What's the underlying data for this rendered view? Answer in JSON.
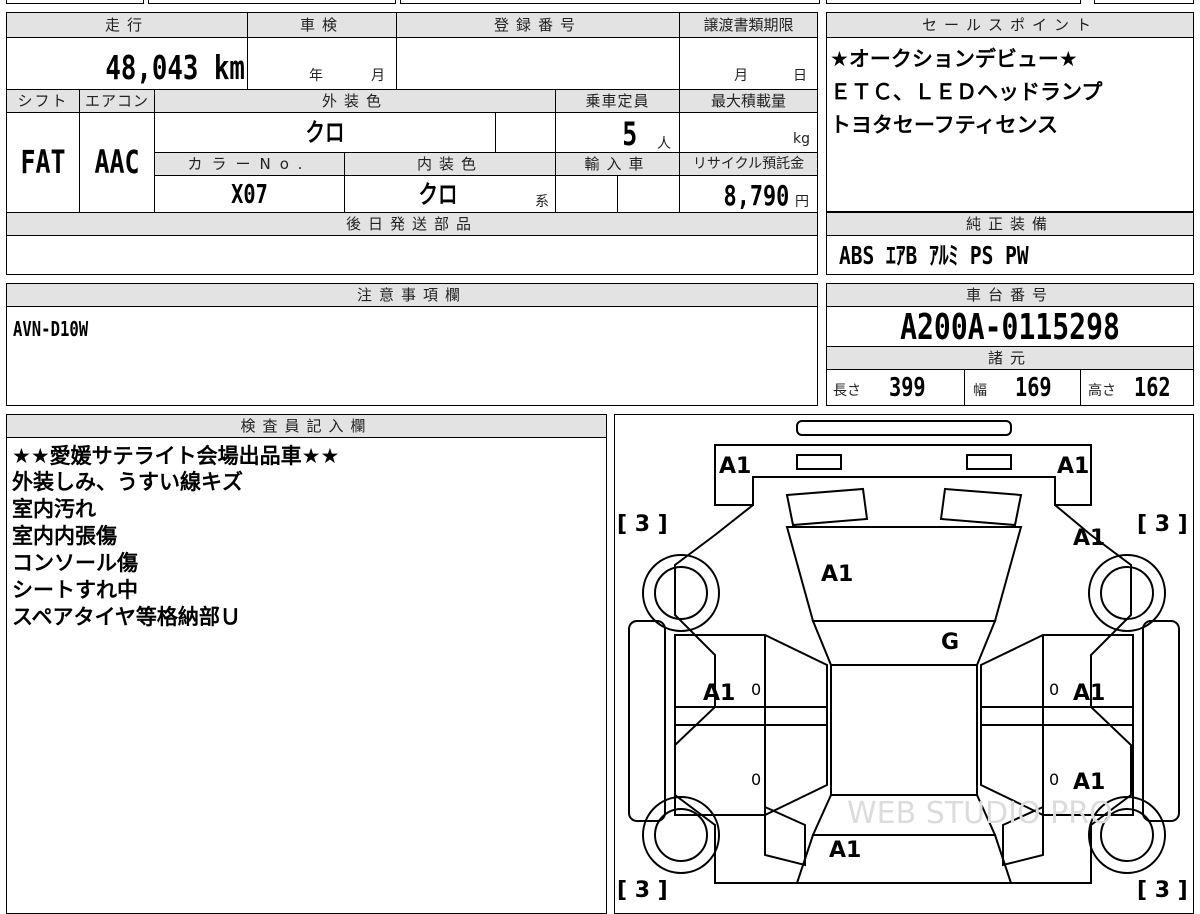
{
  "vehicle": {
    "headers": {
      "mileage": "走行",
      "inspection": "車検",
      "registration": "登録番号",
      "transfer_deadline": "譲渡書類期限",
      "shift": "シフト",
      "aircon": "エアコン",
      "exterior_color": "外装色",
      "capacity": "乗車定員",
      "max_load": "最大積載量",
      "color_no": "カラーNo.",
      "interior_color": "内装色",
      "imported": "輸入車",
      "recycle_fee": "リサイクル預託金",
      "later_parts": "後日発送部品"
    },
    "mileage": "48,043 km",
    "inspection_year_unit": "年",
    "inspection_month_unit": "月",
    "transfer_month_unit": "月",
    "transfer_day_unit": "日",
    "shift": "FAT",
    "aircon": "AAC",
    "exterior_color": "クロ",
    "capacity": "5",
    "capacity_unit": "人",
    "max_load_unit": "kg",
    "color_no": "X07",
    "interior_color": "クロ",
    "interior_color_suffix": "系",
    "recycle_fee": "8,790",
    "recycle_fee_unit": "円"
  },
  "sales_points": {
    "header": "セールスポイント",
    "lines": [
      "★オークションデビュー★",
      "ＥＴＣ、ＬＥＤヘッドランプ",
      "トヨタセーフティセンス"
    ]
  },
  "equipment": {
    "header": "純正装備",
    "value": "ABS ｴｱB ｱﾙﾐ PS PW"
  },
  "notes": {
    "header": "注意事項欄",
    "value": "AVN-D10W"
  },
  "chassis": {
    "header": "車台番号",
    "number": "A200A-0115298",
    "specs_header": "諸元",
    "length_label": "長さ",
    "length": "399",
    "width_label": "幅",
    "width": "169",
    "height_label": "高さ",
    "height": "162"
  },
  "inspector": {
    "header": "検査員記入欄",
    "lines": [
      "★★愛媛サテライト会場出品車★★",
      "外装しみ、うすい線キズ",
      "室内汚れ",
      "室内内張傷",
      "コンソール傷",
      "シートすれ中",
      "スペアタイヤ等格納部Ｕ"
    ]
  },
  "diagram": {
    "front_left": "A1",
    "front_right": "A1",
    "hood": "A1",
    "windshield": "G",
    "front_door_left": "A1",
    "front_door_right": "A1",
    "rear_door_right": "A1",
    "fender_right": "A1",
    "rear_hatch": "A1",
    "tire_fl": "[ 3 ]",
    "tire_fr": "[ 3 ]",
    "tire_rl": "[ 3 ]",
    "tire_rr": "[ 3 ]",
    "zero_fl": "0",
    "zero_fr": "0",
    "zero_rl": "0",
    "zero_rr": "0",
    "watermark": "WEB STUDIO PRO"
  }
}
